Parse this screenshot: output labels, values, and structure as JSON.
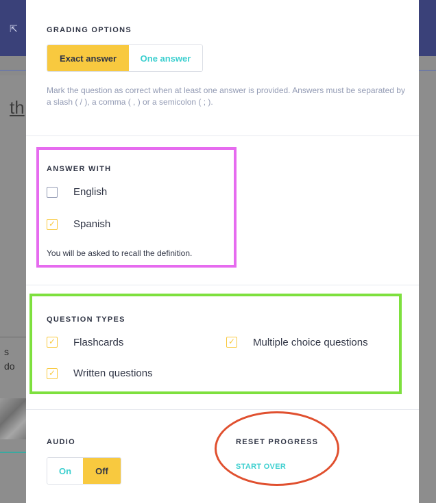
{
  "background": {
    "header_icon": "external-link-icon",
    "partial_text": "th",
    "side_text_1": "s",
    "side_text_2": "do"
  },
  "grading": {
    "title": "GRADING OPTIONS",
    "options": [
      "Exact answer",
      "One answer"
    ],
    "selected": "Exact answer",
    "help": "Mark the question as correct when at least one answer is provided. Answers must be separated by a slash ( / ), a comma ( , ) or a semicolon ( ; )."
  },
  "answer_with": {
    "title": "ANSWER WITH",
    "options": [
      {
        "label": "English",
        "checked": false
      },
      {
        "label": "Spanish",
        "checked": true
      }
    ],
    "note": "You will be asked to recall the definition."
  },
  "question_types": {
    "title": "QUESTION TYPES",
    "options": [
      {
        "label": "Flashcards",
        "checked": true
      },
      {
        "label": "Multiple choice questions",
        "checked": true
      },
      {
        "label": "Written questions",
        "checked": true
      }
    ]
  },
  "audio": {
    "title": "AUDIO",
    "options": [
      "On",
      "Off"
    ],
    "selected": "Off"
  },
  "reset": {
    "title": "RESET PROGRESS",
    "link": "START OVER"
  },
  "colors": {
    "accent_yellow": "#f8c93f",
    "accent_teal": "#3ccfcf",
    "annotation_magenta": "#e66bef",
    "annotation_green": "#7ee03e",
    "annotation_red": "#e0502f"
  }
}
